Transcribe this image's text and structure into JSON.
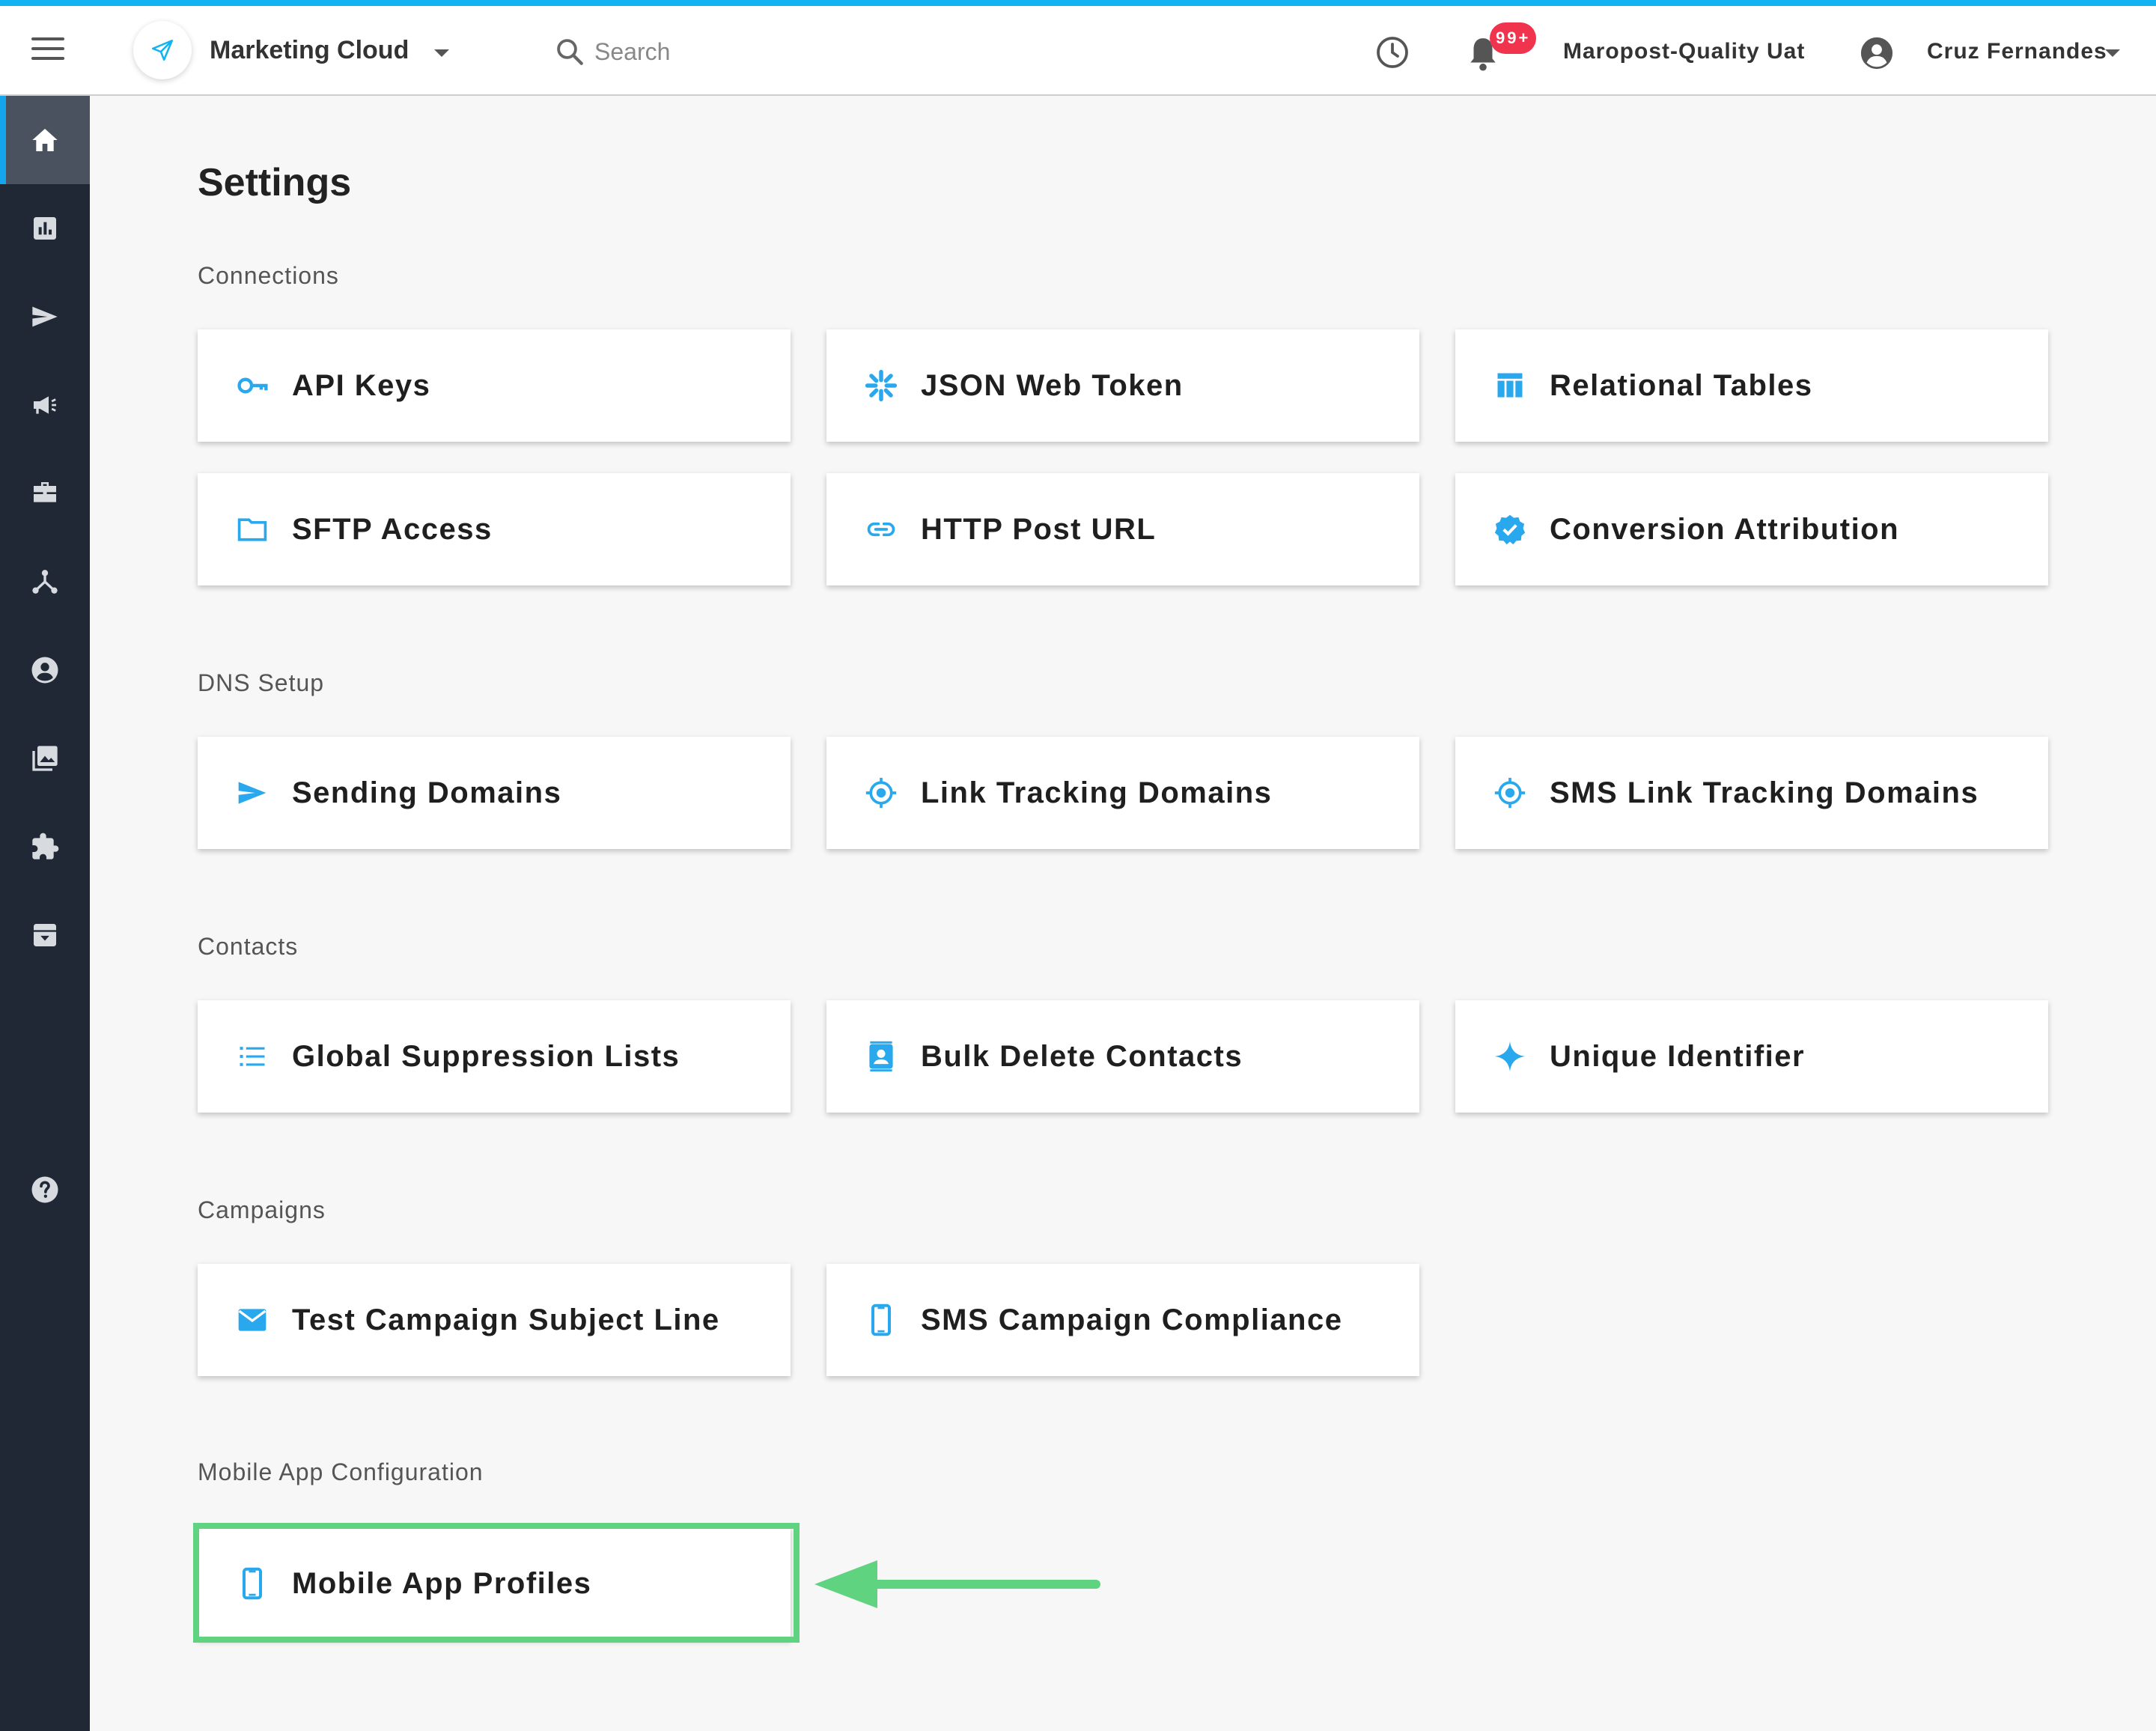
{
  "header": {
    "app_name": "Marketing Cloud",
    "search_placeholder": "Search",
    "notification_count": "99+",
    "account_name": "Maropost-Quality Uat",
    "user_name": "Cruz Fernandes"
  },
  "sidebar": {
    "items": [
      {
        "icon": "home-icon",
        "active": true
      },
      {
        "icon": "reports-icon",
        "active": false
      },
      {
        "icon": "send-icon",
        "active": false
      },
      {
        "icon": "campaign-megaphone-icon",
        "active": false
      },
      {
        "icon": "briefcase-icon",
        "active": false
      },
      {
        "icon": "journey-icon",
        "active": false
      },
      {
        "icon": "contacts-icon",
        "active": false
      },
      {
        "icon": "media-library-icon",
        "active": false
      },
      {
        "icon": "extensions-icon",
        "active": false
      },
      {
        "icon": "archive-icon",
        "active": false
      },
      {
        "icon": "help-icon",
        "active": false
      }
    ]
  },
  "page": {
    "title": "Settings",
    "sections": [
      {
        "title": "Connections",
        "cards": [
          {
            "label": "API Keys",
            "icon": "key-icon"
          },
          {
            "label": "JSON Web Token",
            "icon": "asterisk-icon"
          },
          {
            "label": "Relational Tables",
            "icon": "table-icon"
          },
          {
            "label": "SFTP Access",
            "icon": "folder-icon"
          },
          {
            "label": "HTTP Post URL",
            "icon": "link-icon"
          },
          {
            "label": "Conversion Attribution",
            "icon": "verified-icon"
          }
        ]
      },
      {
        "title": "DNS Setup",
        "cards": [
          {
            "label": "Sending Domains",
            "icon": "send-icon"
          },
          {
            "label": "Link Tracking Domains",
            "icon": "target-icon"
          },
          {
            "label": "SMS Link Tracking Domains",
            "icon": "target-icon"
          }
        ]
      },
      {
        "title": "Contacts",
        "cards": [
          {
            "label": "Global Suppression Lists",
            "icon": "list-icon"
          },
          {
            "label": "Bulk Delete Contacts",
            "icon": "contact-card-icon"
          },
          {
            "label": "Unique Identifier",
            "icon": "sparkle-icon"
          }
        ]
      },
      {
        "title": "Campaigns",
        "cards": [
          {
            "label": "Test Campaign Subject Line",
            "icon": "mail-icon"
          },
          {
            "label": "SMS Campaign Compliance",
            "icon": "phone-icon"
          }
        ]
      },
      {
        "title": "Mobile App Configuration",
        "cards": [
          {
            "label": "Mobile App Profiles",
            "icon": "phone-icon",
            "highlighted": true
          }
        ]
      }
    ]
  },
  "colors": {
    "accent": "#12b3f0",
    "icon_blue": "#2aa8ee",
    "sidebar_bg": "#202836",
    "highlight_green": "#5fd37f",
    "badge_red": "#f0344d"
  }
}
